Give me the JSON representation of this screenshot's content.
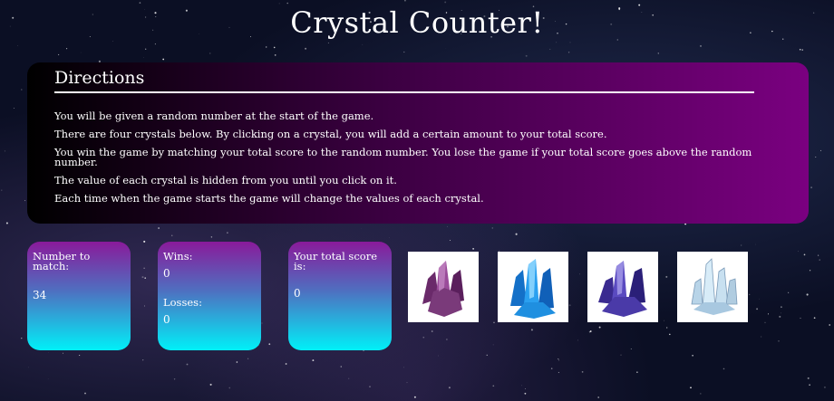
{
  "title": "Crystal Counter!",
  "directions": {
    "heading": "Directions",
    "lines": [
      "You will be given a random number at the start of the game.",
      "There are four crystals below. By clicking on a crystal, you will add a certain amount to your total score.",
      "You win the game by matching your total score to the random number. You lose the game if your total score goes above the random number.",
      "The value of each crystal is hidden from you until you click on it.",
      "Each time when the game starts the game will change the values of each crystal."
    ]
  },
  "target": {
    "label": "Number to match:",
    "value": "34"
  },
  "stats": {
    "wins_label": "Wins:",
    "wins": "0",
    "losses_label": "Losses:",
    "losses": "0"
  },
  "score": {
    "label": "Your total score is:",
    "value": "0"
  },
  "crystals": [
    {
      "icon": "purple-crystal-icon",
      "color": "#7a3a7a"
    },
    {
      "icon": "blue-crystal-icon",
      "color": "#1f8fe0"
    },
    {
      "icon": "indigo-crystal-icon",
      "color": "#4a3aa8"
    },
    {
      "icon": "clear-crystal-icon",
      "color": "#a8c8e0"
    }
  ]
}
